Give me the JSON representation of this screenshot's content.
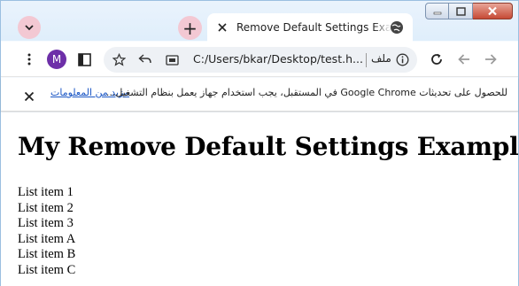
{
  "browser": {
    "tab": {
      "title": "Remove Default Settings Example"
    },
    "new_tab_label": "+",
    "profile_initial": "M",
    "address_bar": {
      "url": "C:/Users/bkar/Desktop/test.h...",
      "file_label": "ملف"
    }
  },
  "infobar": {
    "message": "للحصول على تحديثات Google Chrome في المستقبل، يجب استخدام جهاز يعمل بنظام التشغيل...",
    "link": "مزيد من المعلومات"
  },
  "page": {
    "heading": "My Remove Default Settings Example",
    "list_items": [
      "List item 1",
      "List item 2",
      "List item 3",
      "List item A",
      "List item B",
      "List item C"
    ]
  },
  "colors": {
    "tab_strip": "#dfeefb",
    "pink_button": "#f3c8d3",
    "avatar": "#6d2fa8",
    "link": "#1a56c5"
  }
}
